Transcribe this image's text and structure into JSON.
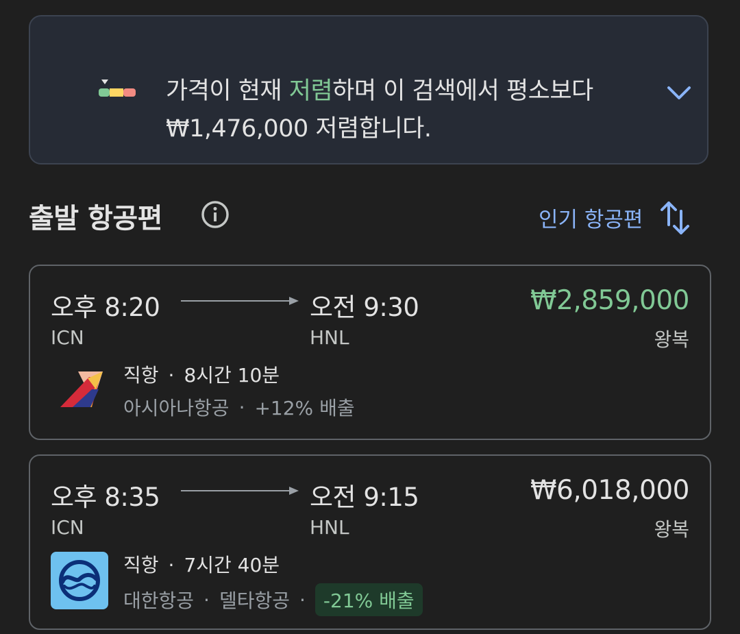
{
  "insight": {
    "text_before": "가격이 현재 ",
    "highlight": "저렴",
    "text_after": "하며 이 검색에서 평소보다 ₩1,476,000 저렴합니다.",
    "icon": "price-gauge-icon",
    "expand_icon": "chevron-down-icon",
    "highlight_color": "#81c995"
  },
  "section": {
    "title": "출발 항공편",
    "info_icon": "info-icon",
    "sort_label": "인기 항공편",
    "sort_icon": "sort-arrows-icon",
    "accent_color": "#8ab4f8"
  },
  "flights": [
    {
      "depart_time": "오후 8:20",
      "arrive_time": "오전 9:30",
      "depart_code": "ICN",
      "arrive_code": "HNL",
      "price": "₩2,859,000",
      "price_color": "#81c995",
      "trip_type": "왕복",
      "stops": "직항",
      "duration": "8시간 10분",
      "airline": "아시아나항공",
      "emissions": "+12% 배출",
      "logo": "asiana-airlines-logo"
    },
    {
      "depart_time": "오후 8:35",
      "arrive_time": "오전 9:15",
      "depart_code": "ICN",
      "arrive_code": "HNL",
      "price": "₩6,018,000",
      "price_color": "#e3e3e3",
      "trip_type": "왕복",
      "stops": "직항",
      "duration": "7시간 40분",
      "airline": "대한항공",
      "partner": "델타항공",
      "emissions": "-21% 배출",
      "logo": "korean-air-logo"
    }
  ]
}
